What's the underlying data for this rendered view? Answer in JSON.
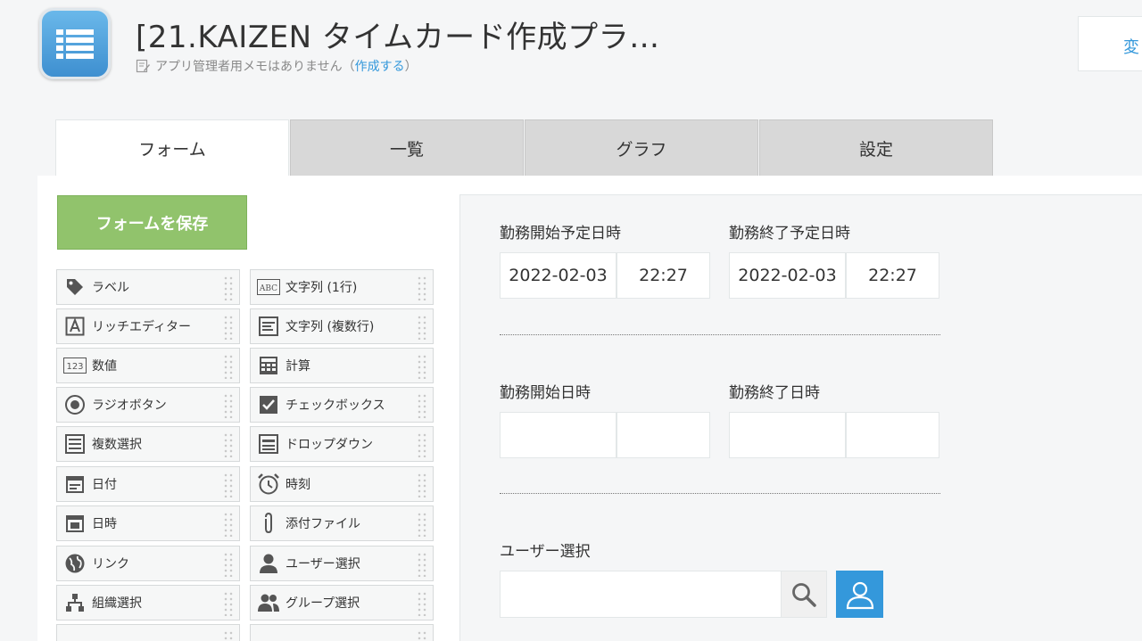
{
  "header": {
    "title": "[21.KAIZEN タイムカード作成プラ…",
    "memo_text": "アプリ管理者用メモはありません（",
    "memo_link": "作成する",
    "memo_close": "）",
    "change_label": "変"
  },
  "tabs": [
    "フォーム",
    "一覧",
    "グラフ",
    "設定"
  ],
  "save_label": "フォームを保存",
  "palette": {
    "left": [
      {
        "label": "ラベル",
        "icon": "tag-icon"
      },
      {
        "label": "リッチエディター",
        "icon": "rich-editor-icon"
      },
      {
        "label": "数値",
        "icon": "number-icon"
      },
      {
        "label": "ラジオボタン",
        "icon": "radio-icon"
      },
      {
        "label": "複数選択",
        "icon": "multi-select-icon"
      },
      {
        "label": "日付",
        "icon": "date-icon"
      },
      {
        "label": "日時",
        "icon": "datetime-icon"
      },
      {
        "label": "リンク",
        "icon": "globe-icon"
      },
      {
        "label": "組織選択",
        "icon": "org-icon"
      }
    ],
    "right": [
      {
        "label": "文字列 (1行)",
        "icon": "text-single-icon"
      },
      {
        "label": "文字列 (複数行)",
        "icon": "text-multi-icon"
      },
      {
        "label": "計算",
        "icon": "calculator-icon"
      },
      {
        "label": "チェックボックス",
        "icon": "checkbox-icon"
      },
      {
        "label": "ドロップダウン",
        "icon": "dropdown-icon"
      },
      {
        "label": "時刻",
        "icon": "clock-icon"
      },
      {
        "label": "添付ファイル",
        "icon": "paperclip-icon"
      },
      {
        "label": "ユーザー選択",
        "icon": "user-icon"
      },
      {
        "label": "グループ選択",
        "icon": "group-icon"
      }
    ]
  },
  "form": {
    "start_planned": {
      "label": "勤務開始予定日時",
      "date": "2022-02-03",
      "time": "22:27"
    },
    "end_planned": {
      "label": "勤務終了予定日時",
      "date": "2022-02-03",
      "time": "22:27"
    },
    "start_actual": {
      "label": "勤務開始日時",
      "date": "",
      "time": ""
    },
    "end_actual": {
      "label": "勤務終了日時",
      "date": "",
      "time": ""
    },
    "user_select": {
      "label": "ユーザー選択",
      "value": ""
    }
  }
}
